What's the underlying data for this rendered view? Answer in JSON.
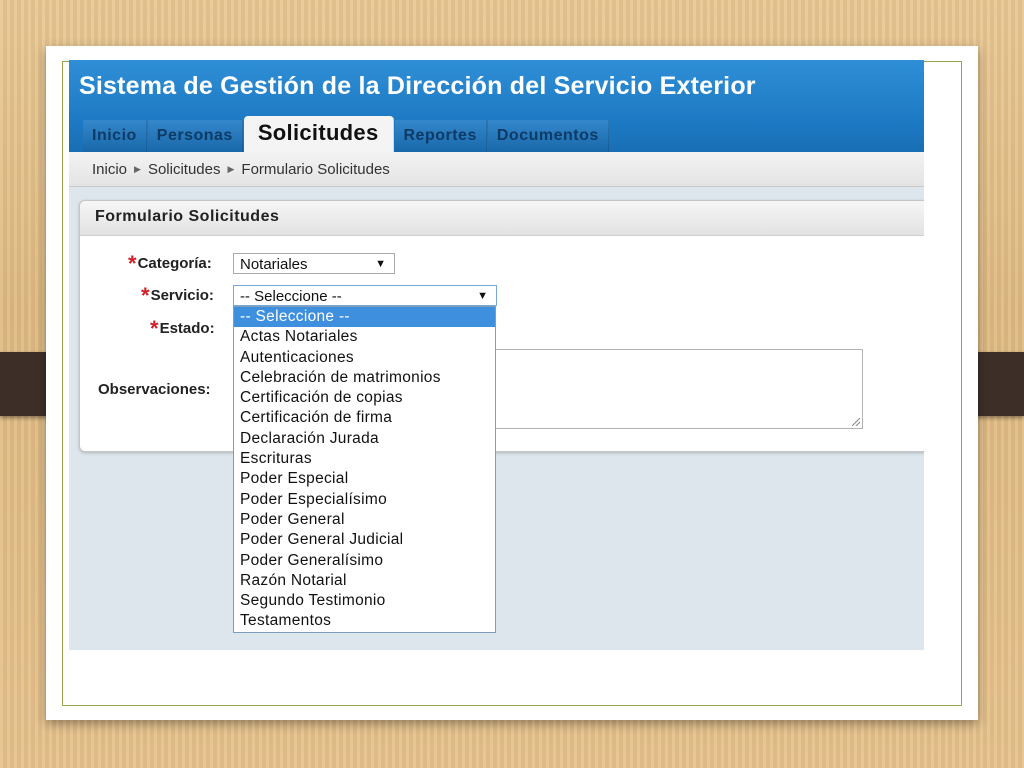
{
  "app": {
    "title": "Sistema de Gestión de la Dirección del Servicio Exterior"
  },
  "nav": {
    "tabs": [
      "Inicio",
      "Personas",
      "Solicitudes",
      "Reportes",
      "Documentos"
    ],
    "active": "Solicitudes"
  },
  "breadcrumb": {
    "items": [
      "Inicio",
      "Solicitudes",
      "Formulario Solicitudes"
    ]
  },
  "form": {
    "title": "Formulario Solicitudes",
    "required_mark": "*",
    "categoria": {
      "label": "Categoría:",
      "value": "Notariales"
    },
    "servicio": {
      "label": "Servicio:",
      "value": "-- Seleccione --"
    },
    "estado": {
      "label": "Estado:"
    },
    "observaciones": {
      "label": "Observaciones:"
    }
  },
  "servicio_options": [
    "-- Seleccione --",
    "Actas Notariales",
    "Autenticaciones",
    "Celebración de matrimonios",
    "Certificación de copias",
    "Certificación de firma",
    "Declaración Jurada",
    "Escrituras",
    "Poder Especial",
    "Poder Especialísimo",
    "Poder General",
    "Poder General Judicial",
    "Poder Generalísimo",
    "Razón Notarial",
    "Segundo Testimonio",
    "Testamentos"
  ],
  "colors": {
    "header_blue": "#1c78c2",
    "selected_option": "#3f8fdf",
    "required": "#d0202a",
    "strap": "#3d2f27"
  },
  "icons": {
    "dropdown": "caret-down-icon",
    "breadcrumb_sep": "caret-right-icon"
  }
}
